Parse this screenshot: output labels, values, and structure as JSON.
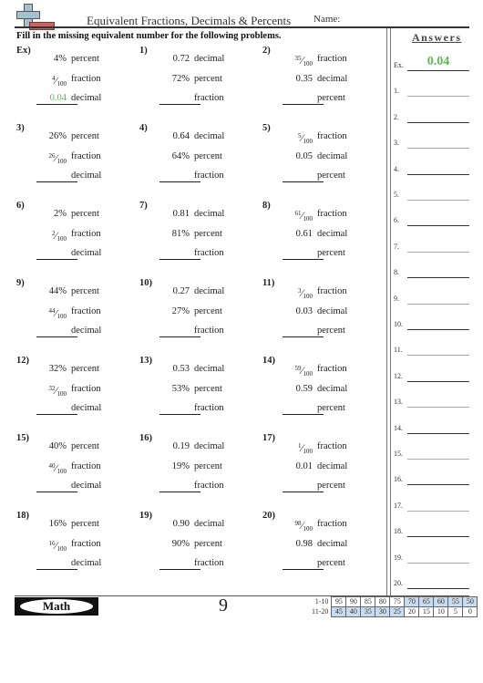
{
  "header": {
    "title": "Equivalent Fractions, Decimals & Percents",
    "name_label": "Name:",
    "instructions": "Fill in the missing equivalent number for the following problems.",
    "logo_icon": "plus-minus-icon"
  },
  "answers_panel": {
    "title": "Answers",
    "items": [
      {
        "label": "Ex.",
        "value": "0.04"
      },
      {
        "label": "1.",
        "value": ""
      },
      {
        "label": "2.",
        "value": ""
      },
      {
        "label": "3.",
        "value": ""
      },
      {
        "label": "4.",
        "value": ""
      },
      {
        "label": "5.",
        "value": ""
      },
      {
        "label": "6.",
        "value": ""
      },
      {
        "label": "7.",
        "value": ""
      },
      {
        "label": "8.",
        "value": ""
      },
      {
        "label": "9.",
        "value": ""
      },
      {
        "label": "10.",
        "value": ""
      },
      {
        "label": "11.",
        "value": ""
      },
      {
        "label": "12.",
        "value": ""
      },
      {
        "label": "13.",
        "value": ""
      },
      {
        "label": "14.",
        "value": ""
      },
      {
        "label": "15.",
        "value": ""
      },
      {
        "label": "16.",
        "value": ""
      },
      {
        "label": "17.",
        "value": ""
      },
      {
        "label": "18.",
        "value": ""
      },
      {
        "label": "19.",
        "value": ""
      },
      {
        "label": "20.",
        "value": ""
      }
    ]
  },
  "problems": [
    {
      "num": "Ex)",
      "rows": [
        {
          "type": "text",
          "value": "4%",
          "label": "percent"
        },
        {
          "type": "frac",
          "num": "4",
          "den": "100",
          "label": "fraction"
        },
        {
          "type": "answer",
          "value": "0.04",
          "label": "decimal"
        }
      ]
    },
    {
      "num": "1)",
      "rows": [
        {
          "type": "text",
          "value": "0.72",
          "label": "decimal"
        },
        {
          "type": "text",
          "value": "72%",
          "label": "percent"
        },
        {
          "type": "blank",
          "label": "fraction"
        }
      ]
    },
    {
      "num": "2)",
      "rows": [
        {
          "type": "frac",
          "num": "35",
          "den": "100",
          "label": "fraction"
        },
        {
          "type": "text",
          "value": "0.35",
          "label": "decimal"
        },
        {
          "type": "blank",
          "label": "percent"
        }
      ]
    },
    {
      "num": "3)",
      "rows": [
        {
          "type": "text",
          "value": "26%",
          "label": "percent"
        },
        {
          "type": "frac",
          "num": "26",
          "den": "100",
          "label": "fraction"
        },
        {
          "type": "blank",
          "label": "decimal"
        }
      ]
    },
    {
      "num": "4)",
      "rows": [
        {
          "type": "text",
          "value": "0.64",
          "label": "decimal"
        },
        {
          "type": "text",
          "value": "64%",
          "label": "percent"
        },
        {
          "type": "blank",
          "label": "fraction"
        }
      ]
    },
    {
      "num": "5)",
      "rows": [
        {
          "type": "frac",
          "num": "5",
          "den": "100",
          "label": "fraction"
        },
        {
          "type": "text",
          "value": "0.05",
          "label": "decimal"
        },
        {
          "type": "blank",
          "label": "percent"
        }
      ]
    },
    {
      "num": "6)",
      "rows": [
        {
          "type": "text",
          "value": "2%",
          "label": "percent"
        },
        {
          "type": "frac",
          "num": "2",
          "den": "100",
          "label": "fraction"
        },
        {
          "type": "blank",
          "label": "decimal"
        }
      ]
    },
    {
      "num": "7)",
      "rows": [
        {
          "type": "text",
          "value": "0.81",
          "label": "decimal"
        },
        {
          "type": "text",
          "value": "81%",
          "label": "percent"
        },
        {
          "type": "blank",
          "label": "fraction"
        }
      ]
    },
    {
      "num": "8)",
      "rows": [
        {
          "type": "frac",
          "num": "61",
          "den": "100",
          "label": "fraction"
        },
        {
          "type": "text",
          "value": "0.61",
          "label": "decimal"
        },
        {
          "type": "blank",
          "label": "percent"
        }
      ]
    },
    {
      "num": "9)",
      "rows": [
        {
          "type": "text",
          "value": "44%",
          "label": "percent"
        },
        {
          "type": "frac",
          "num": "44",
          "den": "100",
          "label": "fraction"
        },
        {
          "type": "blank",
          "label": "decimal"
        }
      ]
    },
    {
      "num": "10)",
      "rows": [
        {
          "type": "text",
          "value": "0.27",
          "label": "decimal"
        },
        {
          "type": "text",
          "value": "27%",
          "label": "percent"
        },
        {
          "type": "blank",
          "label": "fraction"
        }
      ]
    },
    {
      "num": "11)",
      "rows": [
        {
          "type": "frac",
          "num": "3",
          "den": "100",
          "label": "fraction"
        },
        {
          "type": "text",
          "value": "0.03",
          "label": "decimal"
        },
        {
          "type": "blank",
          "label": "percent"
        }
      ]
    },
    {
      "num": "12)",
      "rows": [
        {
          "type": "text",
          "value": "32%",
          "label": "percent"
        },
        {
          "type": "frac",
          "num": "32",
          "den": "100",
          "label": "fraction"
        },
        {
          "type": "blank",
          "label": "decimal"
        }
      ]
    },
    {
      "num": "13)",
      "rows": [
        {
          "type": "text",
          "value": "0.53",
          "label": "decimal"
        },
        {
          "type": "text",
          "value": "53%",
          "label": "percent"
        },
        {
          "type": "blank",
          "label": "fraction"
        }
      ]
    },
    {
      "num": "14)",
      "rows": [
        {
          "type": "frac",
          "num": "59",
          "den": "100",
          "label": "fraction"
        },
        {
          "type": "text",
          "value": "0.59",
          "label": "decimal"
        },
        {
          "type": "blank",
          "label": "percent"
        }
      ]
    },
    {
      "num": "15)",
      "rows": [
        {
          "type": "text",
          "value": "40%",
          "label": "percent"
        },
        {
          "type": "frac",
          "num": "40",
          "den": "100",
          "label": "fraction"
        },
        {
          "type": "blank",
          "label": "decimal"
        }
      ]
    },
    {
      "num": "16)",
      "rows": [
        {
          "type": "text",
          "value": "0.19",
          "label": "decimal"
        },
        {
          "type": "text",
          "value": "19%",
          "label": "percent"
        },
        {
          "type": "blank",
          "label": "fraction"
        }
      ]
    },
    {
      "num": "17)",
      "rows": [
        {
          "type": "frac",
          "num": "1",
          "den": "100",
          "label": "fraction"
        },
        {
          "type": "text",
          "value": "0.01",
          "label": "decimal"
        },
        {
          "type": "blank",
          "label": "percent"
        }
      ]
    },
    {
      "num": "18)",
      "rows": [
        {
          "type": "text",
          "value": "16%",
          "label": "percent"
        },
        {
          "type": "frac",
          "num": "16",
          "den": "100",
          "label": "fraction"
        },
        {
          "type": "blank",
          "label": "decimal"
        }
      ]
    },
    {
      "num": "19)",
      "rows": [
        {
          "type": "text",
          "value": "0.90",
          "label": "decimal"
        },
        {
          "type": "text",
          "value": "90%",
          "label": "percent"
        },
        {
          "type": "blank",
          "label": "fraction"
        }
      ]
    },
    {
      "num": "20)",
      "rows": [
        {
          "type": "frac",
          "num": "98",
          "den": "100",
          "label": "fraction"
        },
        {
          "type": "text",
          "value": "0.98",
          "label": "decimal"
        },
        {
          "type": "blank",
          "label": "percent"
        }
      ]
    }
  ],
  "footer": {
    "subject": "Math",
    "page_number": "9",
    "score_table": {
      "rows": [
        {
          "label": "1-10",
          "cells": [
            "95",
            "90",
            "85",
            "80",
            "75",
            "70",
            "65",
            "60",
            "55",
            "50"
          ],
          "shaded": [
            false,
            false,
            false,
            false,
            false,
            true,
            true,
            true,
            true,
            true
          ]
        },
        {
          "label": "11-20",
          "cells": [
            "45",
            "40",
            "35",
            "30",
            "25",
            "20",
            "15",
            "10",
            "5",
            "0"
          ],
          "shaded": [
            true,
            true,
            true,
            true,
            true,
            false,
            false,
            false,
            false,
            false
          ]
        }
      ]
    },
    "accent_green": "#5cb85c",
    "score_shade": "#c9dbef"
  }
}
